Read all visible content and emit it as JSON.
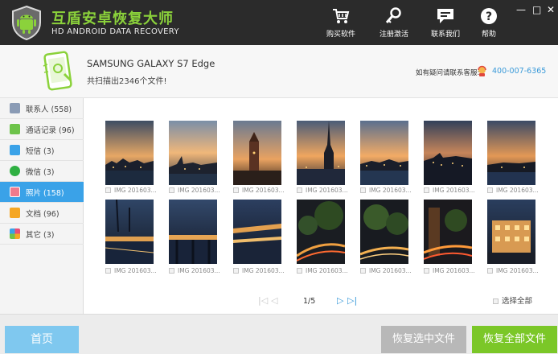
{
  "app": {
    "title": "互盾安卓恢复大师",
    "subtitle": "HD ANDROID DATA RECOVERY"
  },
  "toolbar": [
    {
      "label": "购买软件",
      "icon": "cart-icon"
    },
    {
      "label": "注册激活",
      "icon": "key-icon"
    },
    {
      "label": "联系我们",
      "icon": "chat-icon"
    },
    {
      "label": "帮助",
      "icon": "help-icon"
    }
  ],
  "window_controls": {
    "minimize": "—",
    "maximize": "□",
    "close": "✕"
  },
  "device": {
    "name": "SAMSUNG  GALAXY S7 Edge",
    "scan_summary": "共扫描出2346个文件!"
  },
  "support": {
    "label": "如有疑问请联系客服:",
    "phone": "400-007-6365"
  },
  "sidebar": {
    "items": [
      {
        "label": "联系人 (558)",
        "icon": "contacts-icon",
        "color": "#8a9bb5",
        "active": false
      },
      {
        "label": "通话记录 (96)",
        "icon": "call-log-icon",
        "color": "#6dc34a",
        "active": false
      },
      {
        "label": "短信 (3)",
        "icon": "sms-icon",
        "color": "#3aa2e8",
        "active": false
      },
      {
        "label": "微信 (3)",
        "icon": "wechat-icon",
        "color": "#2fb042",
        "active": false
      },
      {
        "label": "照片 (158)",
        "icon": "photo-icon",
        "color": "#f07a8c",
        "active": true
      },
      {
        "label": "文档 (96)",
        "icon": "document-icon",
        "color": "#f5a623",
        "active": false
      },
      {
        "label": "其它 (3)",
        "icon": "other-icon",
        "color": "#e94e77",
        "active": false
      }
    ]
  },
  "photos": [
    {
      "caption": "IMG 201603..."
    },
    {
      "caption": "IMG 201603..."
    },
    {
      "caption": "IMG 201603..."
    },
    {
      "caption": "IMG 201603..."
    },
    {
      "caption": "IMG 201603..."
    },
    {
      "caption": "IMG 201603..."
    },
    {
      "caption": "IMG 201603..."
    },
    {
      "caption": "IMG 201603..."
    },
    {
      "caption": "IMG 201603..."
    },
    {
      "caption": "IMG 201603..."
    },
    {
      "caption": "IMG 201603..."
    },
    {
      "caption": "IMG 201603..."
    },
    {
      "caption": "IMG 201603..."
    },
    {
      "caption": "IMG 201603..."
    }
  ],
  "pagination": {
    "text": "1/5",
    "first": "|◁",
    "prev": "◁",
    "next": "▷",
    "last": "▷|"
  },
  "select_all": "选择全部",
  "footer": {
    "home": "首页",
    "recover_selected": "恢复选中文件",
    "recover_all": "恢复全部文件"
  },
  "colors": {
    "accent": "#3aa2e8",
    "brand_green": "#8bd23b",
    "recover_all": "#7bc728"
  }
}
